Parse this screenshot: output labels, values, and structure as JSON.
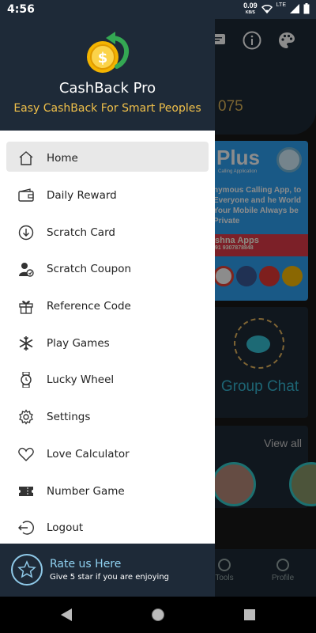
{
  "status_bar": {
    "time": "4:56",
    "speed_value": "0.09",
    "speed_unit": "KB/S",
    "network": "LTE"
  },
  "background": {
    "points_value": "075",
    "card1": {
      "title": "Plus",
      "subtitle": "Calling Application",
      "body": "nymous Calling App, to Everyone and he World Your Mobile Always be Private",
      "banner": "shna Apps",
      "banner_phone": "91 9307878848"
    },
    "card2_label": "Group Chat",
    "card3_link": "View all",
    "bottom_nav": [
      {
        "label": "Tools"
      },
      {
        "label": "Profile"
      }
    ]
  },
  "drawer": {
    "app_title": "CashBack Pro",
    "tagline": "Easy CashBack For Smart Peoples",
    "menu": [
      {
        "label": "Home",
        "icon": "home-icon",
        "active": true
      },
      {
        "label": "Daily Reward",
        "icon": "wallet-icon"
      },
      {
        "label": "Scratch Card",
        "icon": "download-circle-icon"
      },
      {
        "label": "Scratch Coupon",
        "icon": "user-badge-icon"
      },
      {
        "label": "Reference Code",
        "icon": "gift-icon"
      },
      {
        "label": "Play Games",
        "icon": "snowflake-icon"
      },
      {
        "label": "Lucky Wheel",
        "icon": "watch-icon"
      },
      {
        "label": "Settings",
        "icon": "gear-icon"
      },
      {
        "label": "Love Calculator",
        "icon": "heart-icon"
      },
      {
        "label": "Number Game",
        "icon": "ticket-icon"
      },
      {
        "label": "Logout",
        "icon": "logout-icon"
      }
    ],
    "footer": {
      "title": "Rate us Here",
      "subtitle": "Give 5 star if you are enjoying"
    }
  },
  "colors": {
    "header_bg": "#1e2a38",
    "accent_gold": "#f0c04a",
    "accent_blue": "#8fd1f0",
    "active_item_bg": "#e8e8e8"
  }
}
